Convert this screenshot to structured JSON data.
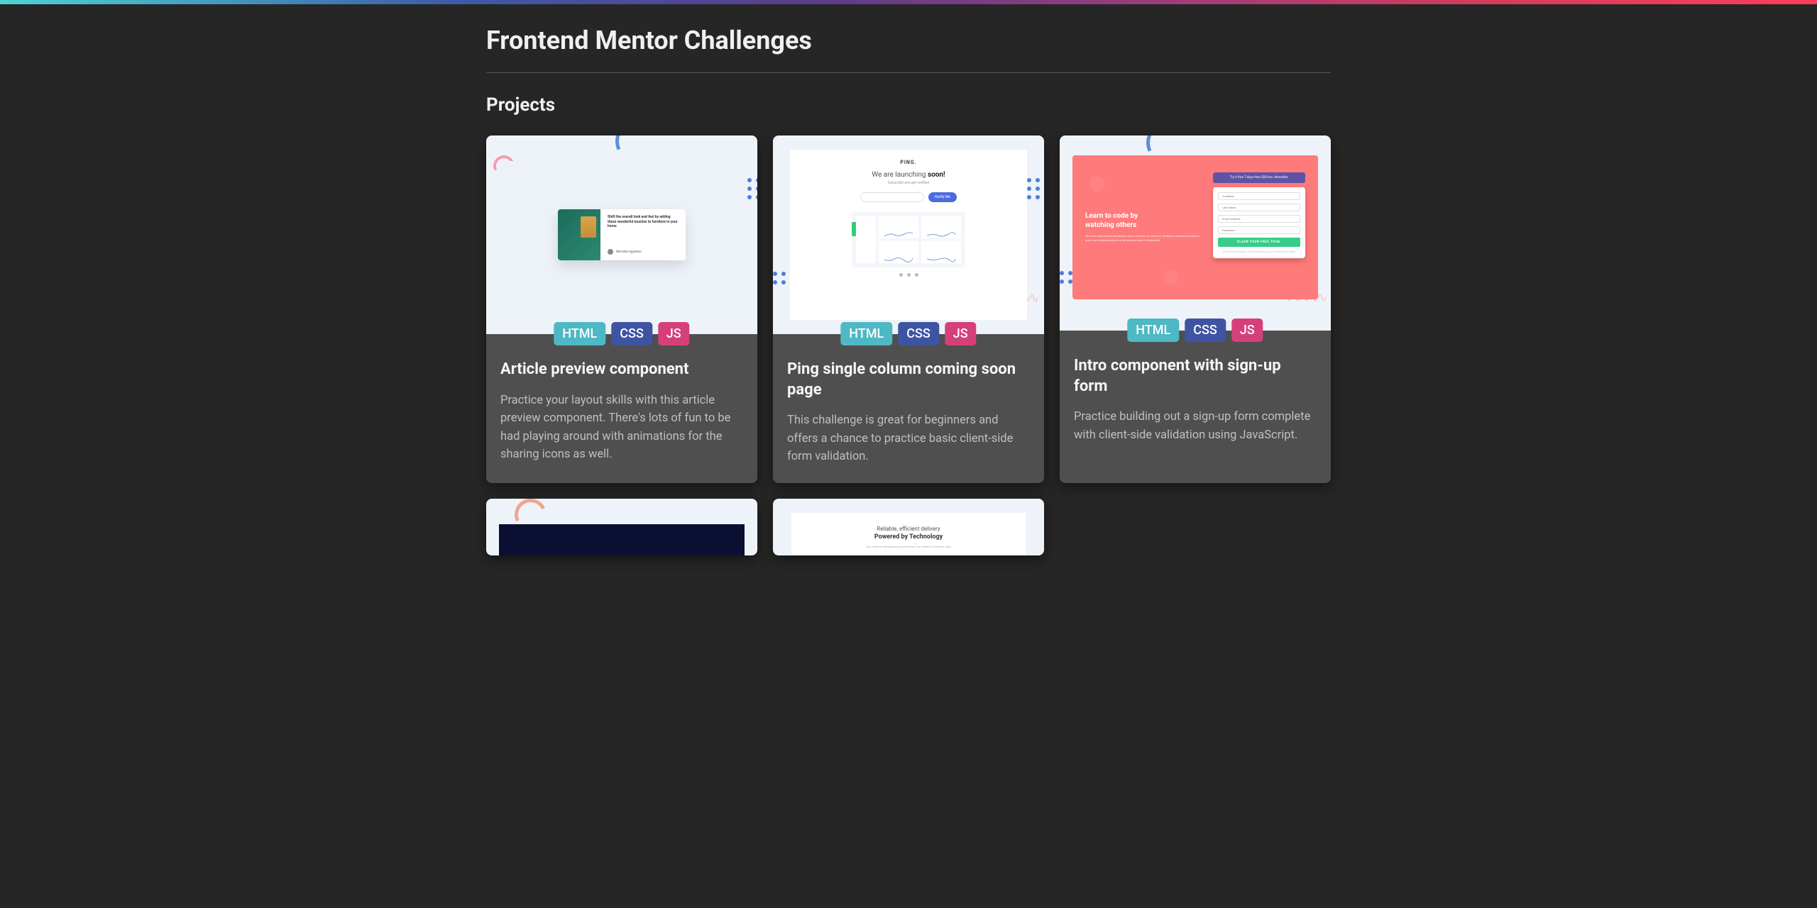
{
  "page": {
    "title": "Frontend Mentor Challenges",
    "section": "Projects"
  },
  "badges": {
    "html": "HTML",
    "css": "CSS",
    "js": "JS"
  },
  "cards": [
    {
      "title": "Article preview component",
      "desc": "Practice your layout skills with this article preview component. There's lots of fun to be had playing around with animations for the sharing icons as well.",
      "thumb": {
        "headline": "Shift the overall look and feel by adding these wonderful touches to furniture in your home",
        "author": "Michelle Appleton"
      }
    },
    {
      "title": "Ping single column coming soon page",
      "desc": "This challenge is great for beginners and offers a chance to practice basic client-side form validation.",
      "thumb": {
        "logo": "PING.",
        "heading_pre": "We are launching ",
        "heading_bold": "soon!",
        "sub": "Subscribe and get notified",
        "btn": "Notify Me"
      }
    },
    {
      "title": "Intro component with sign-up form",
      "desc": "Practice building out a sign-up form complete with client-side validation using JavaScript.",
      "thumb": {
        "hero_l1": "Learn to code by",
        "hero_l2": "watching others",
        "hero_sub": "See how experienced developers solve problems in real-time. Watching scripted tutorials is great, but understanding how developers think is invaluable.",
        "banner": "Try it free 7 days then $20/mo. thereafter",
        "f1": "Jonathan",
        "f2": "Last Name",
        "f3": "Email Address",
        "f4": "Password",
        "submit": "CLAIM YOUR FREE TRIAL",
        "terms": "By clicking the button, you are agreeing to our Terms and Services"
      }
    },
    {
      "title": "",
      "desc": ""
    },
    {
      "title": "",
      "desc": "",
      "thumb": {
        "l1": "Reliable, efficient delivery",
        "l2": "Powered by Technology",
        "sub": "Our Artificial Intelligence powered tools use millions of project data"
      }
    }
  ]
}
